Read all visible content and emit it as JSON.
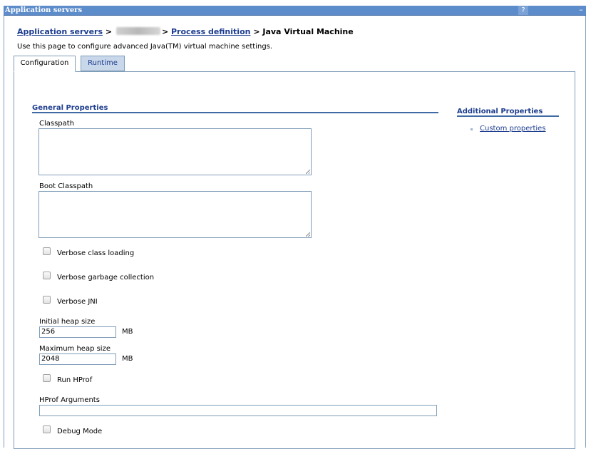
{
  "window": {
    "title": "Application servers",
    "help_label": "?",
    "minimize_label": "–"
  },
  "breadcrumb": {
    "link1": "Application servers",
    "sep": ">",
    "link2": "Process definition",
    "current": "Java Virtual Machine"
  },
  "description": "Use this page to configure advanced Java(TM) virtual machine settings.",
  "tabs": [
    {
      "label": "Configuration",
      "active": true
    },
    {
      "label": "Runtime",
      "active": false
    }
  ],
  "general": {
    "heading": "General Properties",
    "classpath_label": "Classpath",
    "classpath_value": "",
    "boot_classpath_label": "Boot Classpath",
    "boot_classpath_value": "",
    "checkboxes": [
      {
        "label": "Verbose class loading",
        "checked": false
      },
      {
        "label": "Verbose garbage collection",
        "checked": false
      },
      {
        "label": "Verbose JNI",
        "checked": false
      }
    ],
    "initial_heap_label": "Initial heap size",
    "initial_heap_value": "256",
    "initial_heap_unit": "MB",
    "max_heap_label": "Maximum heap size",
    "max_heap_value": "2048",
    "max_heap_unit": "MB",
    "run_hprof_label": "Run HProf",
    "hprof_args_label": "HProf Arguments",
    "hprof_args_value": "",
    "debug_mode_label": "Debug Mode"
  },
  "additional": {
    "heading": "Additional Properties",
    "links": [
      "Custom properties"
    ]
  },
  "colors": {
    "titlebar": "#5d8ccb",
    "link": "#1c3c8e",
    "border": "#7f9db9",
    "tab_inactive": "#c9d7ea"
  }
}
